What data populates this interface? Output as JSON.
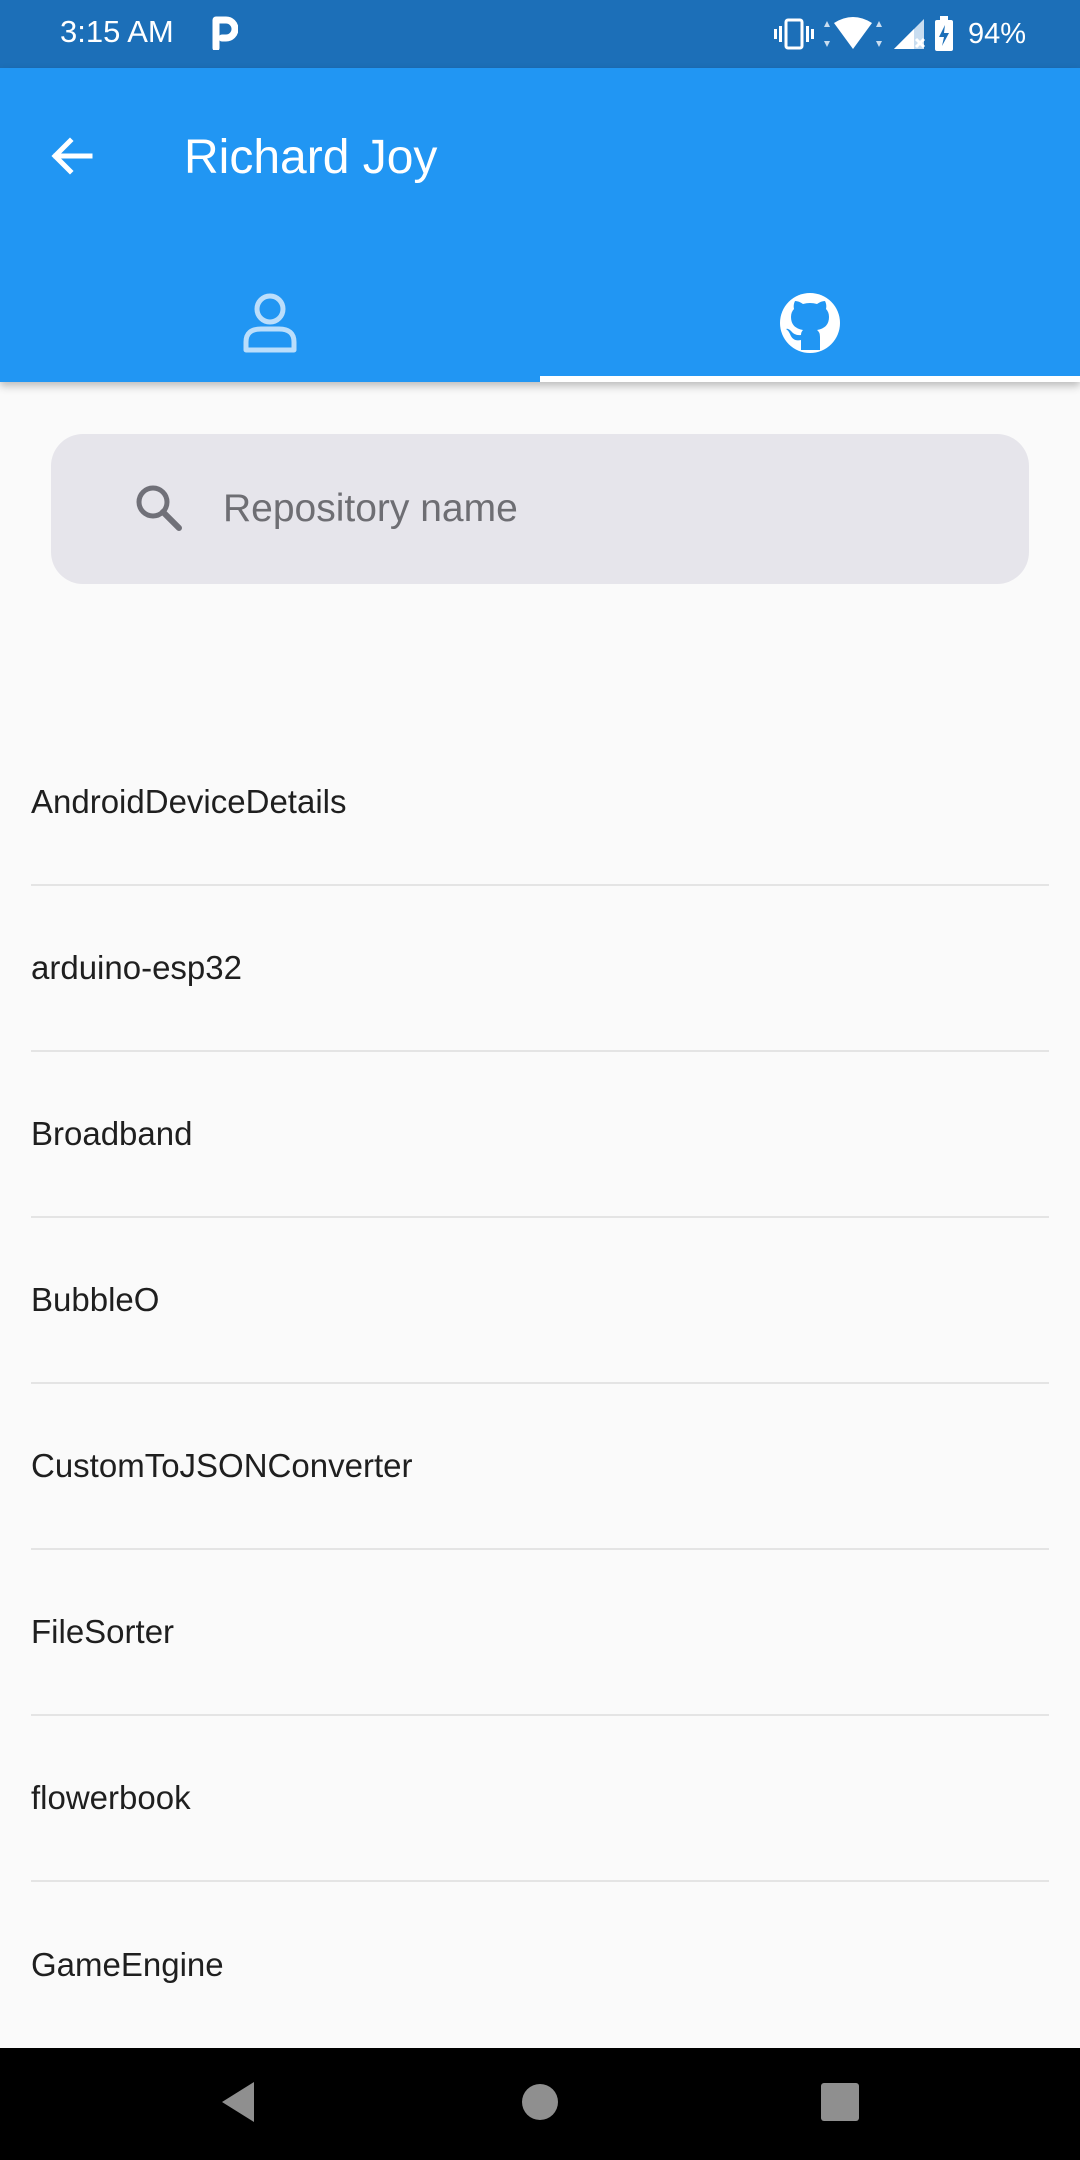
{
  "status_bar": {
    "time": "3:15 AM",
    "battery": "94%",
    "icons": [
      "parking-notification-icon",
      "vibrate-icon",
      "wifi-icon",
      "cell-signal-icon",
      "battery-charging-icon"
    ]
  },
  "app_bar": {
    "title": "Richard Joy",
    "back_icon": "arrow-back-icon",
    "tabs": [
      {
        "icon": "person-outline-icon",
        "selected": false
      },
      {
        "icon": "github-icon",
        "selected": true
      }
    ],
    "color": "#2196F3"
  },
  "search": {
    "placeholder": "Repository name",
    "value": ""
  },
  "repositories": [
    "AndroidDeviceDetails",
    "arduino-esp32",
    "Broadband",
    "BubbleO",
    "CustomToJSONConverter",
    "FileSorter",
    "flowerbook",
    "GameEngine"
  ],
  "nav_bar": {
    "buttons": [
      "back-triangle-icon",
      "home-circle-icon",
      "recents-square-icon"
    ]
  }
}
